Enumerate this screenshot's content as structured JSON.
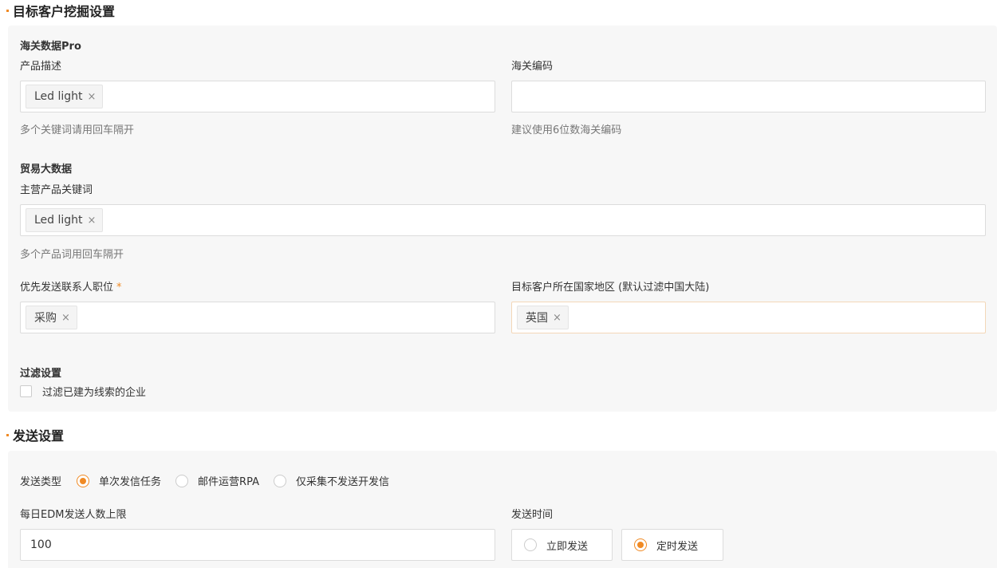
{
  "section1": {
    "title": "目标客户挖掘设置",
    "customs": {
      "title": "海关数据Pro",
      "product_desc_label": "产品描述",
      "product_desc_tags": [
        "Led light"
      ],
      "product_desc_hint": "多个关键词请用回车隔开",
      "hs_code_label": "海关编码",
      "hs_code_value": "",
      "hs_code_hint": "建议使用6位数海关编码"
    },
    "trade": {
      "title": "贸易大数据",
      "keywords_label": "主营产品关键词",
      "keywords_tags": [
        "Led light"
      ],
      "keywords_hint": "多个产品词用回车隔开"
    },
    "contact_position_label": "优先发送联系人职位",
    "required_mark": "*",
    "contact_position_tags": [
      "采购"
    ],
    "country_label": "目标客户所在国家地区 (默认过滤中国大陆)",
    "country_tags": [
      "英国"
    ],
    "filter": {
      "title": "过滤设置",
      "checkbox_label": "过滤已建为线索的企业",
      "checked": false
    }
  },
  "section2": {
    "title": "发送设置",
    "send_type_label": "发送类型",
    "send_type_options": [
      "单次发信任务",
      "邮件运营RPA",
      "仅采集不发送开发信"
    ],
    "send_type_selected": 0,
    "daily_limit_label": "每日EDM发送人数上限",
    "daily_limit_value": "100",
    "send_time_label": "发送时间",
    "send_time_options": [
      "立即发送",
      "定时发送"
    ],
    "send_time_selected": 1
  },
  "tag_remove_glyph": "×",
  "colors": {
    "accent": "#f08a24",
    "panel_bg": "#f7f7f7"
  }
}
